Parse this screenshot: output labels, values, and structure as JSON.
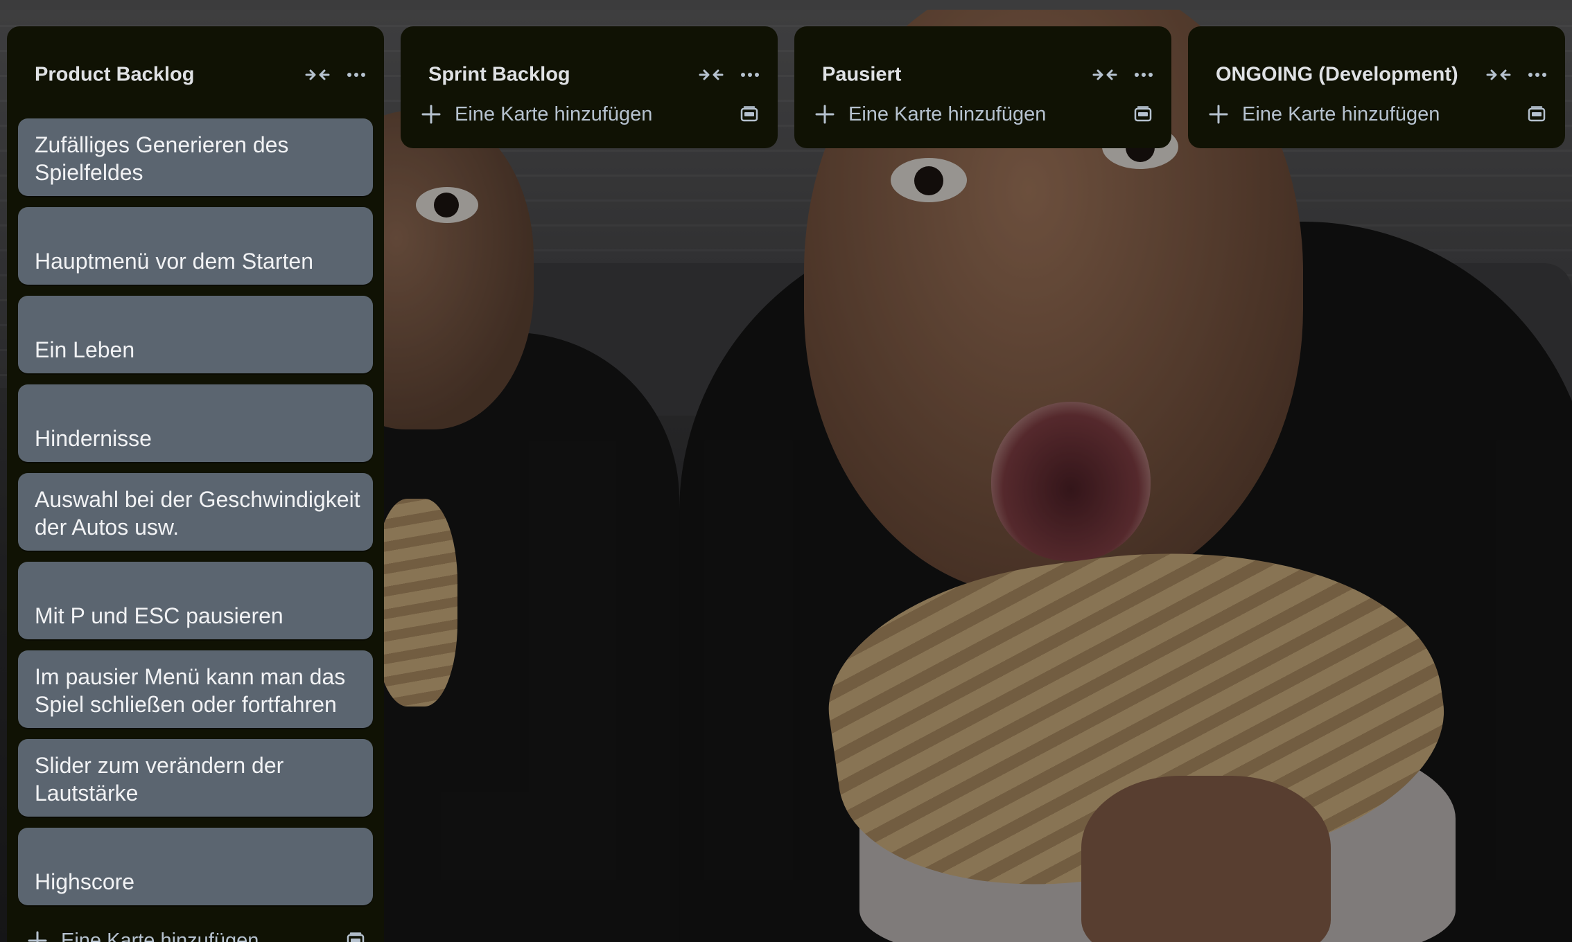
{
  "lists": [
    {
      "title": "Product Backlog",
      "cards": [
        "Zufälliges Generieren des Spielfeldes",
        "Hauptmenü vor dem Starten",
        "Ein Leben",
        "Hindernisse",
        "Auswahl bei der Geschwindigkeit der Autos usw.",
        "Mit P und ESC pausieren",
        "Im pausier Menü kann man das Spiel schließen oder fortfahren",
        "Slider zum verändern der Lautstärke",
        "Highscore"
      ],
      "add_label": "Eine Karte hinzufügen"
    },
    {
      "title": "Sprint Backlog",
      "cards": [],
      "add_label": "Eine Karte hinzufügen"
    },
    {
      "title": "Pausiert",
      "cards": [],
      "add_label": "Eine Karte hinzufügen"
    },
    {
      "title": "ONGOING (Development)",
      "cards": [],
      "add_label": "Eine Karte hinzufügen"
    }
  ],
  "icons": {
    "collapse": "collapse-arrows-icon",
    "more": "more-horizontal-icon",
    "add": "plus-icon",
    "template": "card-template-icon"
  },
  "colors": {
    "list_bg": "#101204",
    "card_bg": "#5b6570",
    "card_text": "#f1f2f4",
    "list_text": "#b6c2cf"
  }
}
